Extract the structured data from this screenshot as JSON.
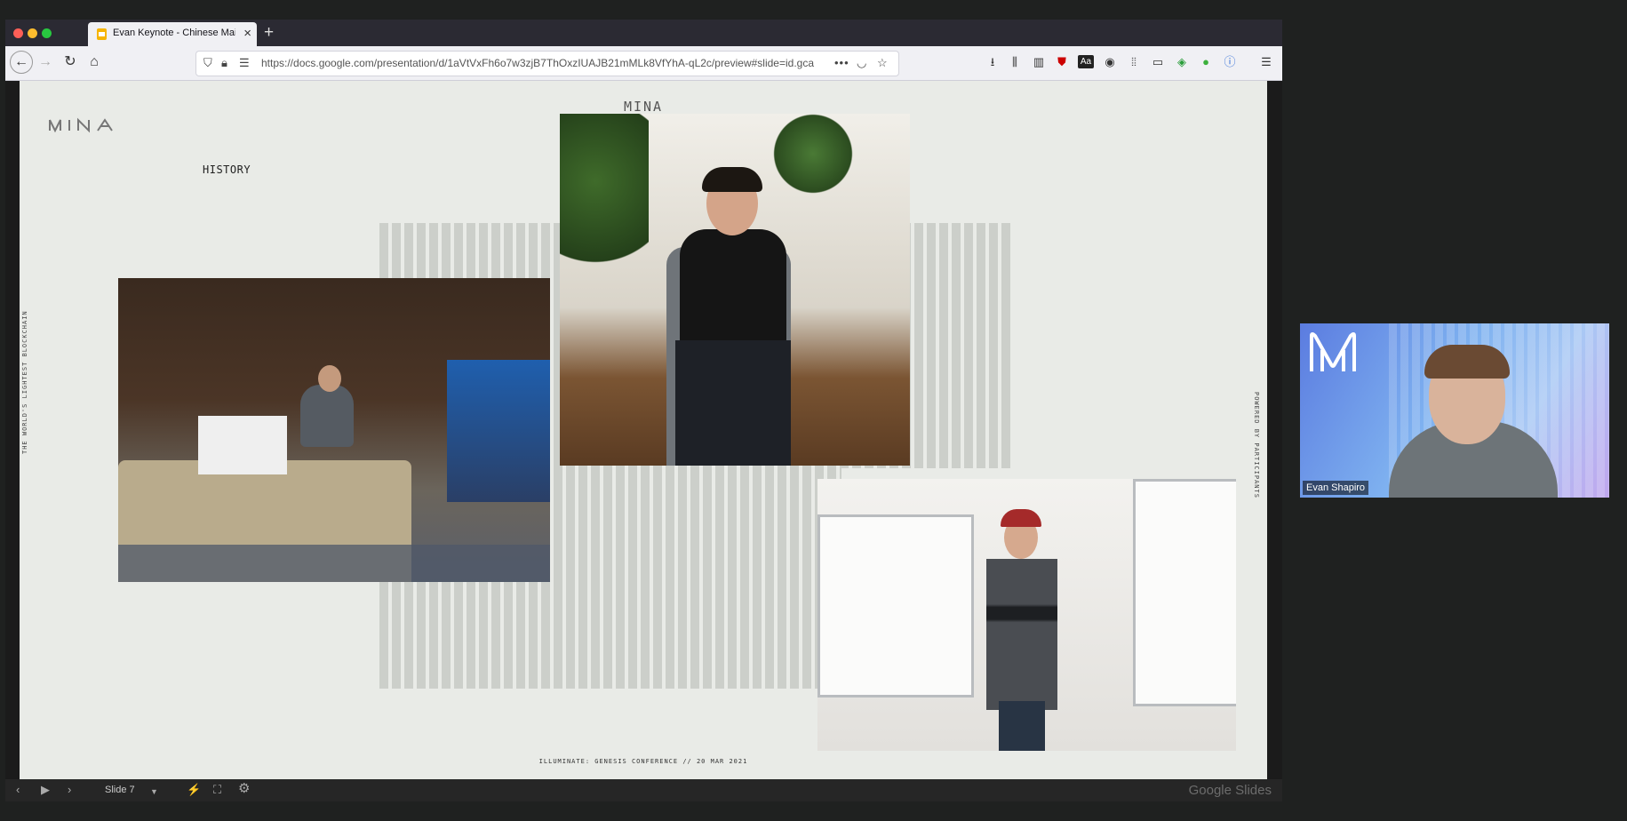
{
  "browser": {
    "tab_title": "Evan Keynote - Chinese Mainland",
    "url": "https://docs.google.com/presentation/d/1aVtVxFh6o7w3zjB7ThOxzIUAJB21mMLk8VfYhA-qL2c/preview#slide=id.gca"
  },
  "slide": {
    "header": "MINA",
    "section_title": "HISTORY",
    "left_vertical": "THE WORLD'S LIGHTEST BLOCKCHAIN",
    "right_vertical": "POWERED BY PARTICIPANTS",
    "footer": "ILLUMINATE: GENESIS CONFERENCE // 20 MAR 2021"
  },
  "slides_toolbar": {
    "slide_label": "Slide 7",
    "brand": "Google Slides"
  },
  "video": {
    "participant_name": "Evan Shapiro"
  },
  "colors": {
    "accent_tab_icon": "#f6b400",
    "slide_background": "#e9ebe7"
  }
}
